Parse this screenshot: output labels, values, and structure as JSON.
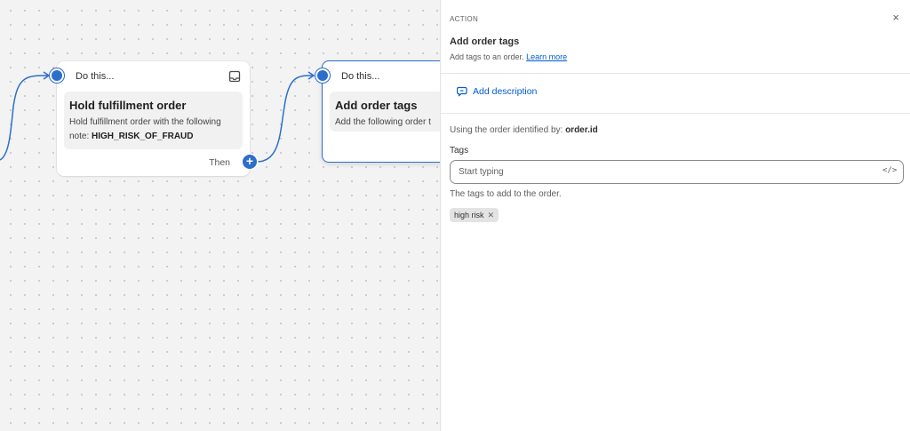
{
  "canvas": {
    "nodes": [
      {
        "head": "Do this...",
        "title": "Hold fulfillment order",
        "desc_prefix": "Hold fulfillment order with the following note: ",
        "desc_bold": "HIGH_RISK_OF_FRAUD",
        "then": "Then"
      },
      {
        "head": "Do this...",
        "title": "Add order tags",
        "desc": "Add the following order t"
      }
    ],
    "accent_color": "#2c6ecb"
  },
  "panel": {
    "kicker": "ACTION",
    "close_icon": "×",
    "title": "Add order tags",
    "subtitle": "Add tags to an order.",
    "learn_more": "Learn more",
    "add_description": "Add description",
    "using_prefix": "Using the order identified by: ",
    "using_value": "order.id",
    "tags_label": "Tags",
    "tags_placeholder": "Start typing",
    "code_icon": "</>",
    "help_text": "The tags to add to the order.",
    "tags": [
      "high risk"
    ]
  }
}
